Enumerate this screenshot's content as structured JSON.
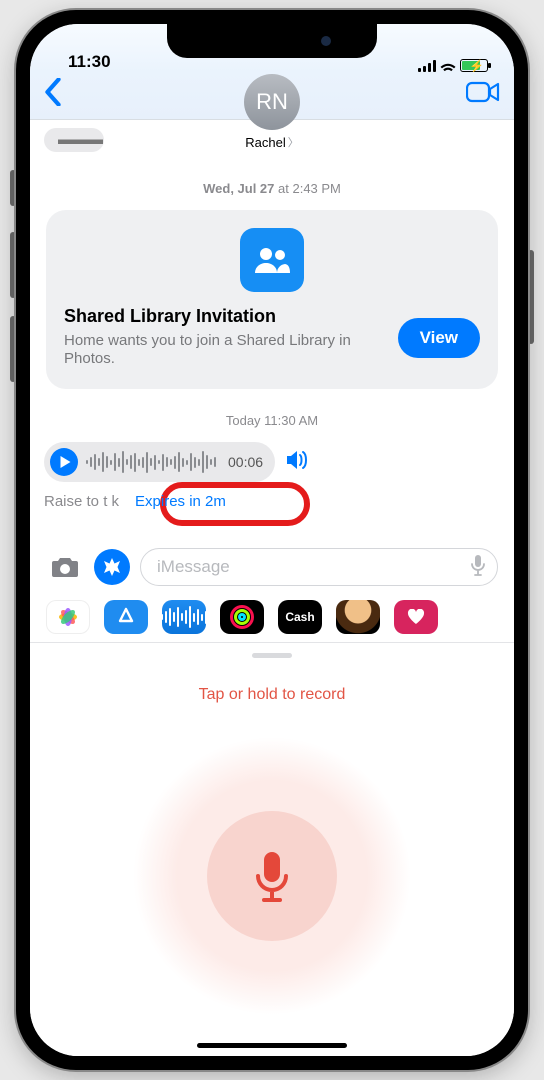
{
  "status": {
    "time": "11:30"
  },
  "header": {
    "avatar_initials": "RN",
    "contact_name": "Rachel"
  },
  "thread": {
    "timestamp1_prefix": "Wed, Jul 27",
    "timestamp1_suffix": " at 2:43 PM",
    "card": {
      "title": "Shared Library Invitation",
      "subtitle": "Home wants you to join a Shared Library in Photos.",
      "action": "View"
    },
    "timestamp2": "Today 11:30 AM",
    "audio_duration": "00:06",
    "raise_label_partial": "Raise to t    k",
    "expires_label": "Expires in 2m"
  },
  "compose": {
    "placeholder": "iMessage"
  },
  "app_strip": {
    "photos": "photos-app",
    "appstore": "appstore-app",
    "audio": "audio-app",
    "fitness": "fitness-app",
    "cash_label": "Cash",
    "memoji": "memoji-app",
    "heart": "digitaltouch-app"
  },
  "record": {
    "hint": "Tap or hold to record"
  }
}
